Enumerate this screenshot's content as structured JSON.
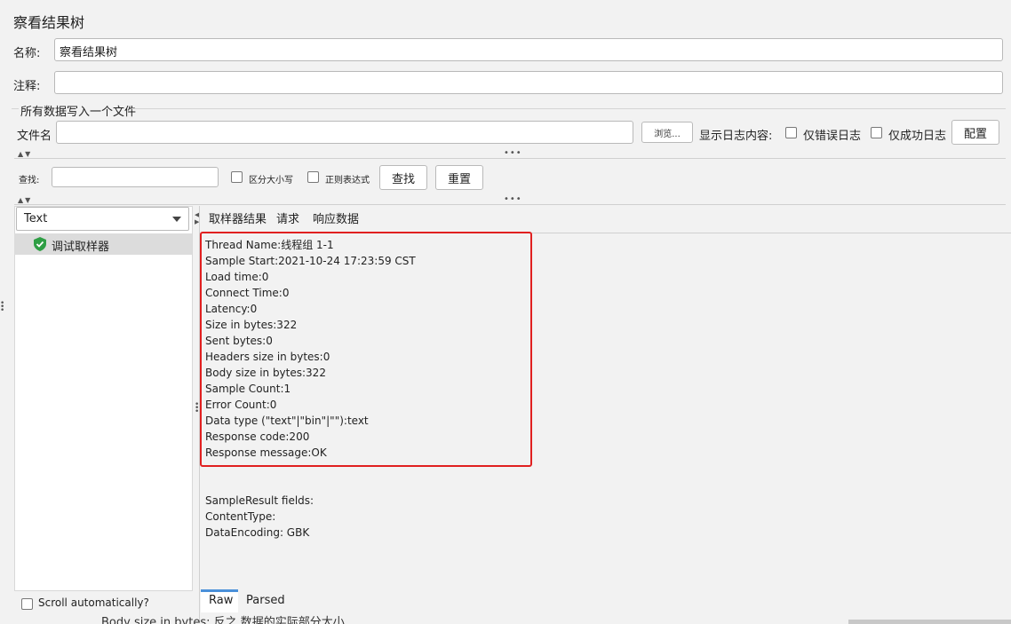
{
  "title": "察看结果树",
  "name_field": {
    "label": "名称:",
    "value": "察看结果树"
  },
  "comment_field": {
    "label": "注释:",
    "value": ""
  },
  "file_section": {
    "legend": "所有数据写入一个文件",
    "filename_label": "文件名",
    "filename_value": "",
    "browse_label": "浏览...",
    "log_content_label": "显示日志内容:",
    "errors_only_label": "仅错误日志",
    "success_only_label": "仅成功日志",
    "config_label": "配置"
  },
  "search_bar": {
    "search_label": "查找:",
    "search_value": "",
    "case_sensitive_label": "区分大小写",
    "regex_label": "正则表达式",
    "find_button": "查找",
    "reset_button": "重置"
  },
  "renderer": {
    "selected": "Text"
  },
  "tree": {
    "items": [
      {
        "label": "调试取样器",
        "status": "success"
      }
    ]
  },
  "result_tabs": [
    "取样器结果",
    "请求",
    "响应数据"
  ],
  "sampler_result": {
    "lines": [
      "Thread Name:线程组 1-1",
      "Sample Start:2021-10-24 17:23:59 CST",
      "Load time:0",
      "Connect Time:0",
      "Latency:0",
      "Size in bytes:322",
      "Sent bytes:0",
      "Headers size in bytes:0",
      "Body size in bytes:322",
      "Sample Count:1",
      "Error Count:0",
      "Data type (\"text\"|\"bin\"|\"\"):text",
      "Response code:200",
      "Response message:OK"
    ],
    "fields_lines": [
      "SampleResult fields:",
      "ContentType:",
      "DataEncoding: GBK"
    ]
  },
  "scroll_auto_label": "Scroll automatically?",
  "bottom_tabs": [
    "Raw",
    "Parsed"
  ],
  "overflow_text": "Body size in bytes: 反之 数据的实际部分大小",
  "colors": {
    "accent": "#4a90d9",
    "highlight_box": "#e02020",
    "success": "#2e9e44"
  }
}
